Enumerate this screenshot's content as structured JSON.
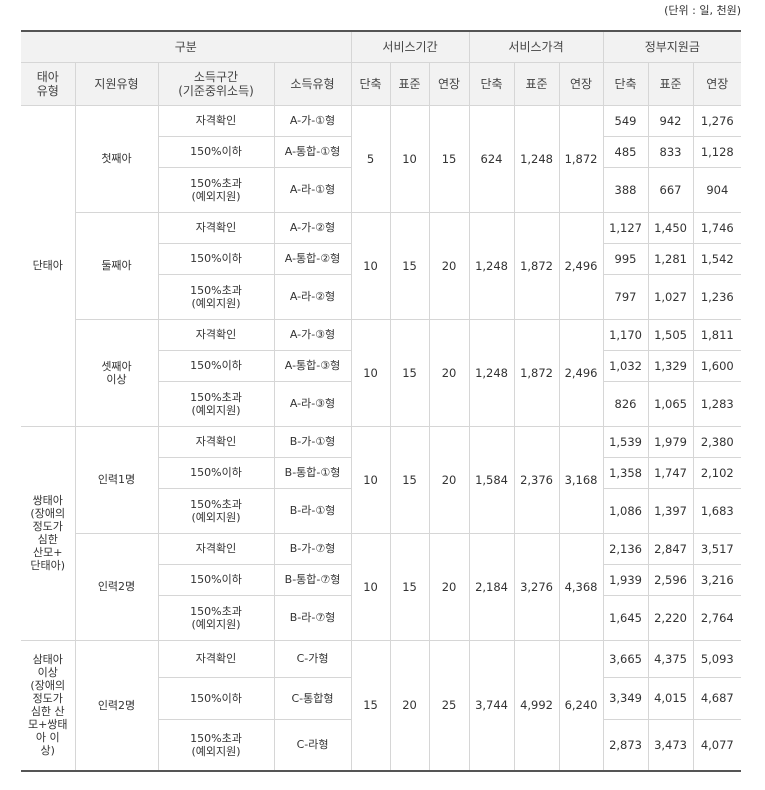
{
  "unit_note": "(단위 : 일, 천원)",
  "headers": {
    "group_label": "구분",
    "service_period": "서비스기간",
    "service_price": "서비스가격",
    "gov_support": "정부지원금",
    "fetus_type": "태아\n유형",
    "support_type": "지원유형",
    "income_range": "소득구간\n(기준중위소득)",
    "income_type": "소득유형",
    "sub": [
      "단축",
      "표준",
      "연장",
      "단축",
      "표준",
      "연장",
      "단축",
      "표준",
      "연장"
    ]
  },
  "fetus_groups": [
    {
      "label": "단태아",
      "supports": [
        {
          "label": "첫째아",
          "period": [
            "5",
            "10",
            "15"
          ],
          "price": [
            "624",
            "1,248",
            "1,872"
          ],
          "rows": [
            {
              "income": "자격확인",
              "type": "A-가-①형",
              "gov": [
                "549",
                "942",
                "1,276"
              ]
            },
            {
              "income": "150%이하",
              "type": "A-통합-①형",
              "gov": [
                "485",
                "833",
                "1,128"
              ]
            },
            {
              "income": "150%초과\n(예외지원)",
              "type": "A-라-①형",
              "gov": [
                "388",
                "667",
                "904"
              ]
            }
          ]
        },
        {
          "label": "둘째아",
          "period": [
            "10",
            "15",
            "20"
          ],
          "price": [
            "1,248",
            "1,872",
            "2,496"
          ],
          "rows": [
            {
              "income": "자격확인",
              "type": "A-가-②형",
              "gov": [
                "1,127",
                "1,450",
                "1,746"
              ]
            },
            {
              "income": "150%이하",
              "type": "A-통합-②형",
              "gov": [
                "995",
                "1,281",
                "1,542"
              ]
            },
            {
              "income": "150%초과\n(예외지원)",
              "type": "A-라-②형",
              "gov": [
                "797",
                "1,027",
                "1,236"
              ]
            }
          ]
        },
        {
          "label": "셋째아\n이상",
          "period": [
            "10",
            "15",
            "20"
          ],
          "price": [
            "1,248",
            "1,872",
            "2,496"
          ],
          "rows": [
            {
              "income": "자격확인",
              "type": "A-가-③형",
              "gov": [
                "1,170",
                "1,505",
                "1,811"
              ]
            },
            {
              "income": "150%이하",
              "type": "A-통합-③형",
              "gov": [
                "1,032",
                "1,329",
                "1,600"
              ]
            },
            {
              "income": "150%초과\n(예외지원)",
              "type": "A-라-③형",
              "gov": [
                "826",
                "1,065",
                "1,283"
              ]
            }
          ]
        }
      ]
    },
    {
      "label": "쌍태아\n(장애의\n정도가\n심한\n산모+\n단태아)",
      "supports": [
        {
          "label": "인력1명",
          "period": [
            "10",
            "15",
            "20"
          ],
          "price": [
            "1,584",
            "2,376",
            "3,168"
          ],
          "rows": [
            {
              "income": "자격확인",
              "type": "B-가-①형",
              "gov": [
                "1,539",
                "1,979",
                "2,380"
              ]
            },
            {
              "income": "150%이하",
              "type": "B-통합-①형",
              "gov": [
                "1,358",
                "1,747",
                "2,102"
              ]
            },
            {
              "income": "150%초과\n(예외지원)",
              "type": "B-라-①형",
              "gov": [
                "1,086",
                "1,397",
                "1,683"
              ]
            }
          ]
        },
        {
          "label": "인력2명",
          "period": [
            "10",
            "15",
            "20"
          ],
          "price": [
            "2,184",
            "3,276",
            "4,368"
          ],
          "rows": [
            {
              "income": "자격확인",
              "type": "B-가-⑦형",
              "gov": [
                "2,136",
                "2,847",
                "3,517"
              ]
            },
            {
              "income": "150%이하",
              "type": "B-통합-⑦형",
              "gov": [
                "1,939",
                "2,596",
                "3,216"
              ]
            },
            {
              "income": "150%초과\n(예외지원)",
              "type": "B-라-⑦형",
              "gov": [
                "1,645",
                "2,220",
                "2,764"
              ]
            }
          ]
        }
      ]
    },
    {
      "label": "삼태아\n이상\n(장애의\n정도가\n심한 산\n모+쌍태\n아 이\n상)",
      "supports": [
        {
          "label": "인력2명",
          "period": [
            "15",
            "20",
            "25"
          ],
          "price": [
            "3,744",
            "4,992",
            "6,240"
          ],
          "rows": [
            {
              "income": "자격확인",
              "type": "C-가형",
              "gov": [
                "3,665",
                "4,375",
                "5,093"
              ]
            },
            {
              "income": "150%이하",
              "type": "C-통합형",
              "gov": [
                "3,349",
                "4,015",
                "4,687"
              ]
            },
            {
              "income": "150%초과\n(예외지원)",
              "type": "C-라형",
              "gov": [
                "2,873",
                "3,473",
                "4,077"
              ]
            }
          ]
        }
      ]
    }
  ]
}
